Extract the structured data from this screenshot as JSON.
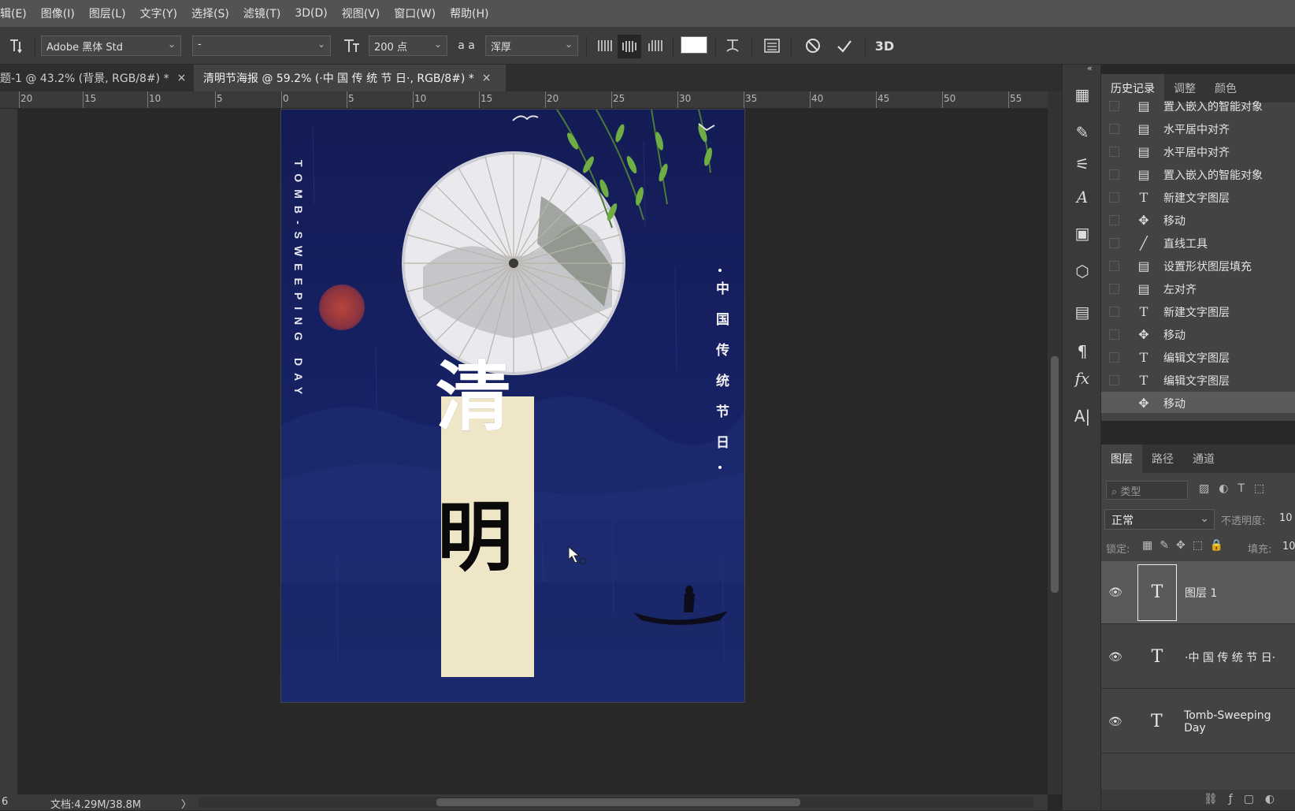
{
  "menu": [
    "辑(E)",
    "图像(I)",
    "图层(L)",
    "文字(Y)",
    "选择(S)",
    "滤镜(T)",
    "3D(D)",
    "视图(V)",
    "窗口(W)",
    "帮助(H)"
  ],
  "options": {
    "font_family": "Adobe 黑体 Std",
    "font_style": "-",
    "font_size": "200 点",
    "aa_label": "a a",
    "antialias": "浑厚",
    "three_d": "3D"
  },
  "tabs": [
    {
      "label": "题-1 @ 43.2% (背景, RGB/8#) *",
      "close": "×"
    },
    {
      "label": "清明节海报 @ 59.2% (·中 国 传 统 节 日·, RGB/8#) *",
      "close": "×"
    }
  ],
  "ruler_ticks": [
    "20",
    "15",
    "10",
    "5",
    "0",
    "5",
    "10",
    "15",
    "20",
    "25",
    "30",
    "35",
    "40",
    "45",
    "50",
    "55"
  ],
  "poster": {
    "english_vertical": "TOMB-SWEEPING DAY",
    "chinese_vertical": "中国传统节日",
    "title_1": "清",
    "title_2": "明"
  },
  "status": {
    "zoom": "6",
    "doc_info": "文档:4.29M/38.8M",
    "arrow": "〉"
  },
  "history": {
    "tabs": [
      "历史记录",
      "调整",
      "颜色"
    ],
    "collapse": "«",
    "items": [
      {
        "icon": "doc-icon",
        "label": "置入嵌入的智能对象"
      },
      {
        "icon": "doc-icon",
        "label": "水平居中对齐"
      },
      {
        "icon": "doc-icon",
        "label": "水平居中对齐"
      },
      {
        "icon": "doc-icon",
        "label": "置入嵌入的智能对象"
      },
      {
        "icon": "type-icon",
        "label": "新建文字图层"
      },
      {
        "icon": "move-icon",
        "label": "移动"
      },
      {
        "icon": "line-icon",
        "label": "直线工具"
      },
      {
        "icon": "doc-icon",
        "label": "设置形状图层填充"
      },
      {
        "icon": "doc-icon",
        "label": "左对齐"
      },
      {
        "icon": "type-icon",
        "label": "新建文字图层"
      },
      {
        "icon": "move-icon",
        "label": "移动"
      },
      {
        "icon": "type-icon",
        "label": "编辑文字图层"
      },
      {
        "icon": "type-icon",
        "label": "编辑文字图层"
      },
      {
        "icon": "move-icon",
        "label": "移动"
      }
    ]
  },
  "layers": {
    "tabs": [
      "图层",
      "路径",
      "通道"
    ],
    "filter_placeholder": "类型",
    "blend_mode": "正常",
    "opacity_label": "不透明度:",
    "opacity_value": "10",
    "lock_label": "锁定:",
    "fill_label": "填充:",
    "fill_value": "10",
    "rows": [
      {
        "name": "图层 1",
        "selected": true
      },
      {
        "name": "·中 国 传 统 节 日·",
        "selected": false
      },
      {
        "name": "Tomb-Sweeping Day",
        "selected": false
      }
    ],
    "eye": "👁"
  }
}
